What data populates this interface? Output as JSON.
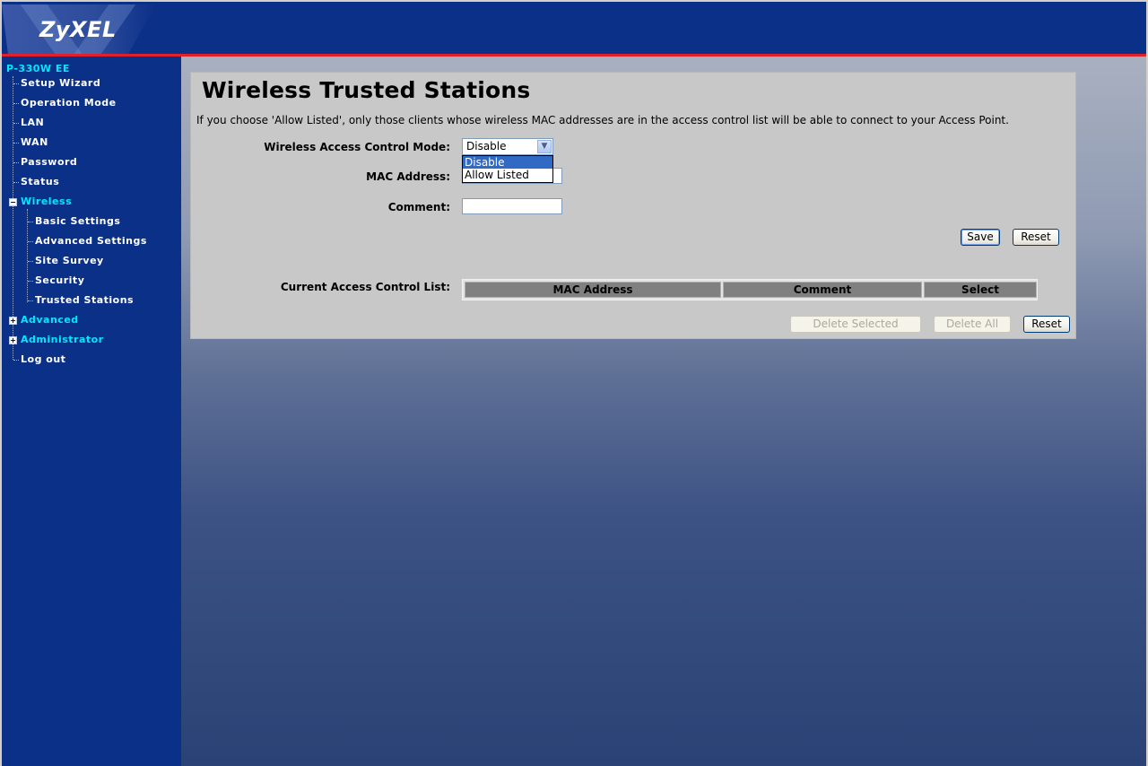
{
  "header": {
    "logo_text": "ZyXEL"
  },
  "sidebar": {
    "model": "P-330W EE",
    "items": [
      {
        "label": "Setup Wizard"
      },
      {
        "label": "Operation Mode"
      },
      {
        "label": "LAN"
      },
      {
        "label": "WAN"
      },
      {
        "label": "Password"
      },
      {
        "label": "Status"
      },
      {
        "label": "Wireless",
        "expander": "−"
      },
      {
        "label": "Basic Settings"
      },
      {
        "label": "Advanced Settings"
      },
      {
        "label": "Site Survey"
      },
      {
        "label": "Security"
      },
      {
        "label": "Trusted Stations"
      },
      {
        "label": "Advanced",
        "expander": "+"
      },
      {
        "label": "Administrator",
        "expander": "+"
      },
      {
        "label": "Log out"
      }
    ]
  },
  "page": {
    "title": "Wireless Trusted Stations",
    "description": "If you choose 'Allow Listed', only those clients whose wireless MAC addresses are in the access control list will be able to connect to your Access Point.",
    "mode_label": "Wireless Access Control Mode:",
    "mode_value": "Disable",
    "mode_options": [
      "Disable",
      "Allow Listed"
    ],
    "mac_label": "MAC Address:",
    "mac_value": "",
    "comment_label": "Comment:",
    "comment_value": "",
    "save_label": "Save",
    "reset_label": "Reset",
    "list_label": "Current Access Control List:",
    "columns": [
      "MAC Address",
      "Comment",
      "Select"
    ],
    "delete_selected_label": "Delete Selected",
    "delete_all_label": "Delete All",
    "reset2_label": "Reset"
  },
  "colors": {
    "nav_bg": "#0b3088",
    "accent_red": "#e0202a",
    "active_nav": "#00e8ff"
  }
}
